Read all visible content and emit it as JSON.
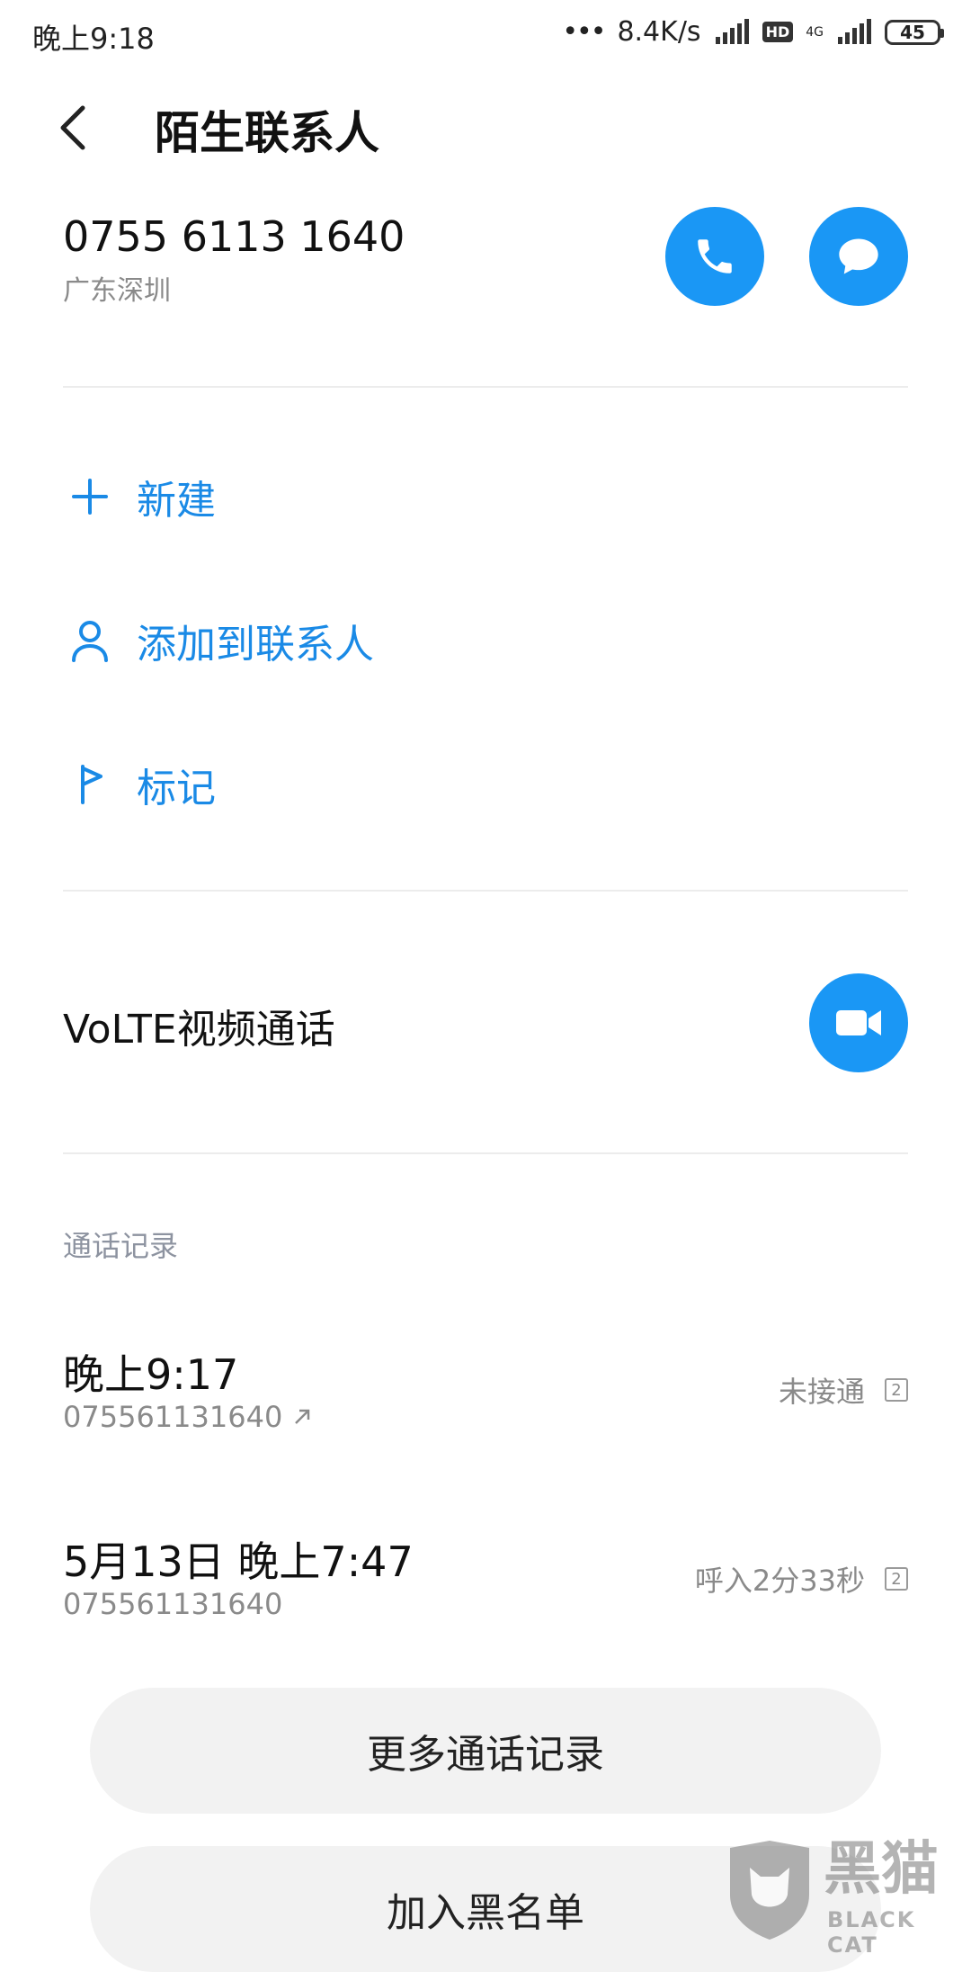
{
  "status_bar": {
    "time": "晚上9:18",
    "network_speed": "8.4K/s",
    "hd": "HD",
    "net_type": "4G",
    "battery": "45"
  },
  "header": {
    "title": "陌生联系人"
  },
  "contact": {
    "number": "0755 6113 1640",
    "location": "广东深圳"
  },
  "actions": [
    {
      "label": "新建",
      "icon": "plus-icon"
    },
    {
      "label": "添加到联系人",
      "icon": "person-icon"
    },
    {
      "label": "标记",
      "icon": "flag-icon"
    }
  ],
  "volte": {
    "label": "VoLTE视频通话"
  },
  "call_log": {
    "section_label": "通话记录",
    "entries": [
      {
        "time": "晚上9:17",
        "number": "075561131640",
        "status": "未接通",
        "sim": "2",
        "direction": "outgoing"
      },
      {
        "time": "5月13日 晚上7:47",
        "number": "075561131640",
        "status": "呼入2分33秒",
        "sim": "2",
        "direction": "incoming"
      }
    ]
  },
  "buttons": {
    "more_records": "更多通话记录",
    "add_blacklist": "加入黑名单"
  },
  "watermark": {
    "brand": "黑猫",
    "brand_en": "BLACK CAT"
  },
  "colors": {
    "accent": "#1a97f5",
    "link": "#1a8ae6"
  }
}
